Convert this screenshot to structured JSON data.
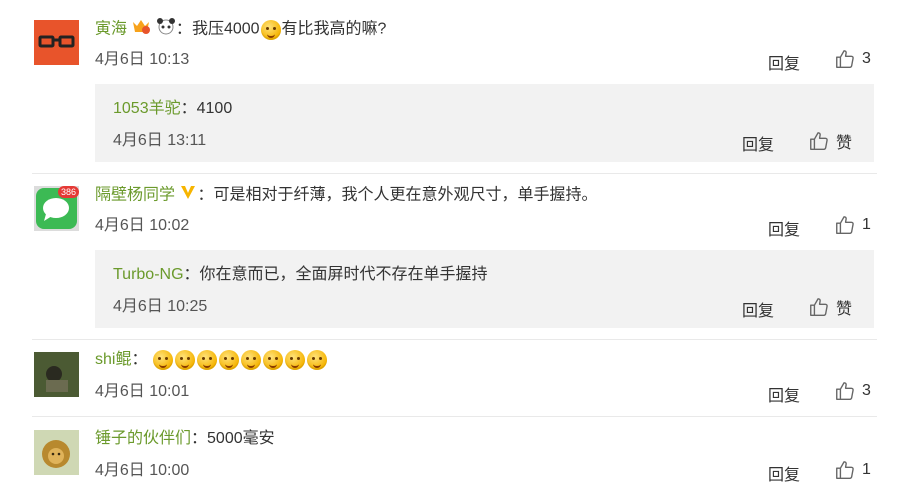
{
  "comments": [
    {
      "user": "寅海",
      "sep": "：",
      "text_a": "我压4000",
      "text_b": "有比我高的嘛?",
      "time": "4月6日 10:13",
      "reply_label": "回复",
      "likes": "3",
      "replies": [
        {
          "user": "1053羊驼",
          "sep": "：",
          "text": "4100",
          "time": "4月6日 13:11",
          "reply_label": "回复",
          "likes": "赞"
        }
      ]
    },
    {
      "user": "隔壁杨同学",
      "avatar_badge": "386",
      "sep": "：",
      "text": "可是相对于纤薄，我个人更在意外观尺寸，单手握持。",
      "time": "4月6日 10:02",
      "reply_label": "回复",
      "likes": "1",
      "replies": [
        {
          "user": "Turbo-NG",
          "sep": "：",
          "text": "你在意而已，全面屏时代不存在单手握持",
          "time": "4月6日 10:25",
          "reply_label": "回复",
          "likes": "赞"
        }
      ]
    },
    {
      "user": "shi鲲",
      "sep": "：",
      "emoji_count": 8,
      "time": "4月6日 10:01",
      "reply_label": "回复",
      "likes": "3"
    },
    {
      "user": "锤子的伙伴们",
      "sep": "：",
      "text": "5000毫安",
      "time": "4月6日 10:00",
      "reply_label": "回复",
      "likes": "1"
    }
  ],
  "colors": {
    "username": "#6b9a2c",
    "sub_bg": "#f2f2f2",
    "avatar1": "#e8542b",
    "avatar2": "#3cba54"
  }
}
